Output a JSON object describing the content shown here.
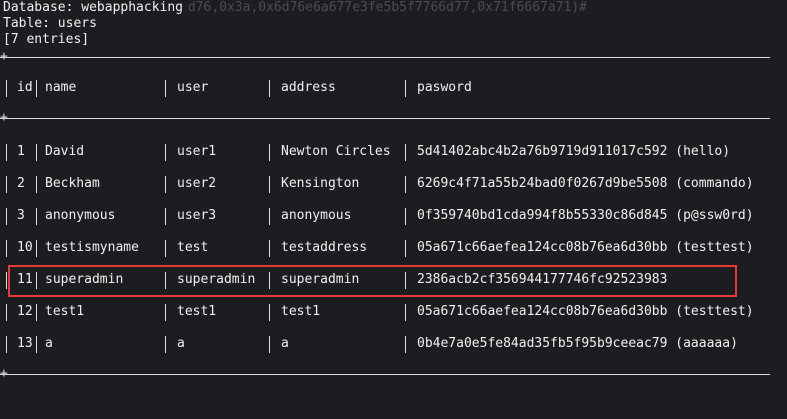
{
  "terminal": {
    "database_line": "Database: webapphacking",
    "table_line": "Table: users",
    "entries_line": "[7 entries]"
  },
  "ghost_text": [
    "                        d76,0x3a,0x6d76e6a677e3fe5b5f7766d77,0x71f6667a71)#",
    "",
    "       *"
  ],
  "table": {
    "columns": [
      "id",
      "name",
      "user",
      "address",
      "pasword"
    ],
    "rows": [
      {
        "id": "1",
        "name": "David",
        "user": "user1",
        "address": "Newton Circles",
        "password": "5d41402abc4b2a76b9719d911017c592 (hello)"
      },
      {
        "id": "2",
        "name": "Beckham",
        "user": "user2",
        "address": "Kensington",
        "password": "6269c4f71a55b24bad0f0267d9be5508 (commando)"
      },
      {
        "id": "3",
        "name": "anonymous",
        "user": "user3",
        "address": "anonymous",
        "password": "0f359740bd1cda994f8b55330c86d845 (p@ssw0rd)"
      },
      {
        "id": "10",
        "name": "testismyname",
        "user": "test",
        "address": "testaddress",
        "password": "05a671c66aefea124cc08b76ea6d30bb (testtest)"
      },
      {
        "id": "11",
        "name": "superadmin",
        "user": "superadmin",
        "address": "superadmin",
        "password": "2386acb2cf356944177746fc92523983"
      },
      {
        "id": "12",
        "name": "test1",
        "user": "test1",
        "address": "test1",
        "password": "05a671c66aefea124cc08b76ea6d30bb (testtest)"
      },
      {
        "id": "13",
        "name": "a",
        "user": "a",
        "address": "a",
        "password": "0b4e7a0e5fe84ad35fb5f95b9ceeac79 (aaaaaa)"
      }
    ]
  },
  "highlight_color": "#e53935",
  "background_color": "#1c1d20"
}
